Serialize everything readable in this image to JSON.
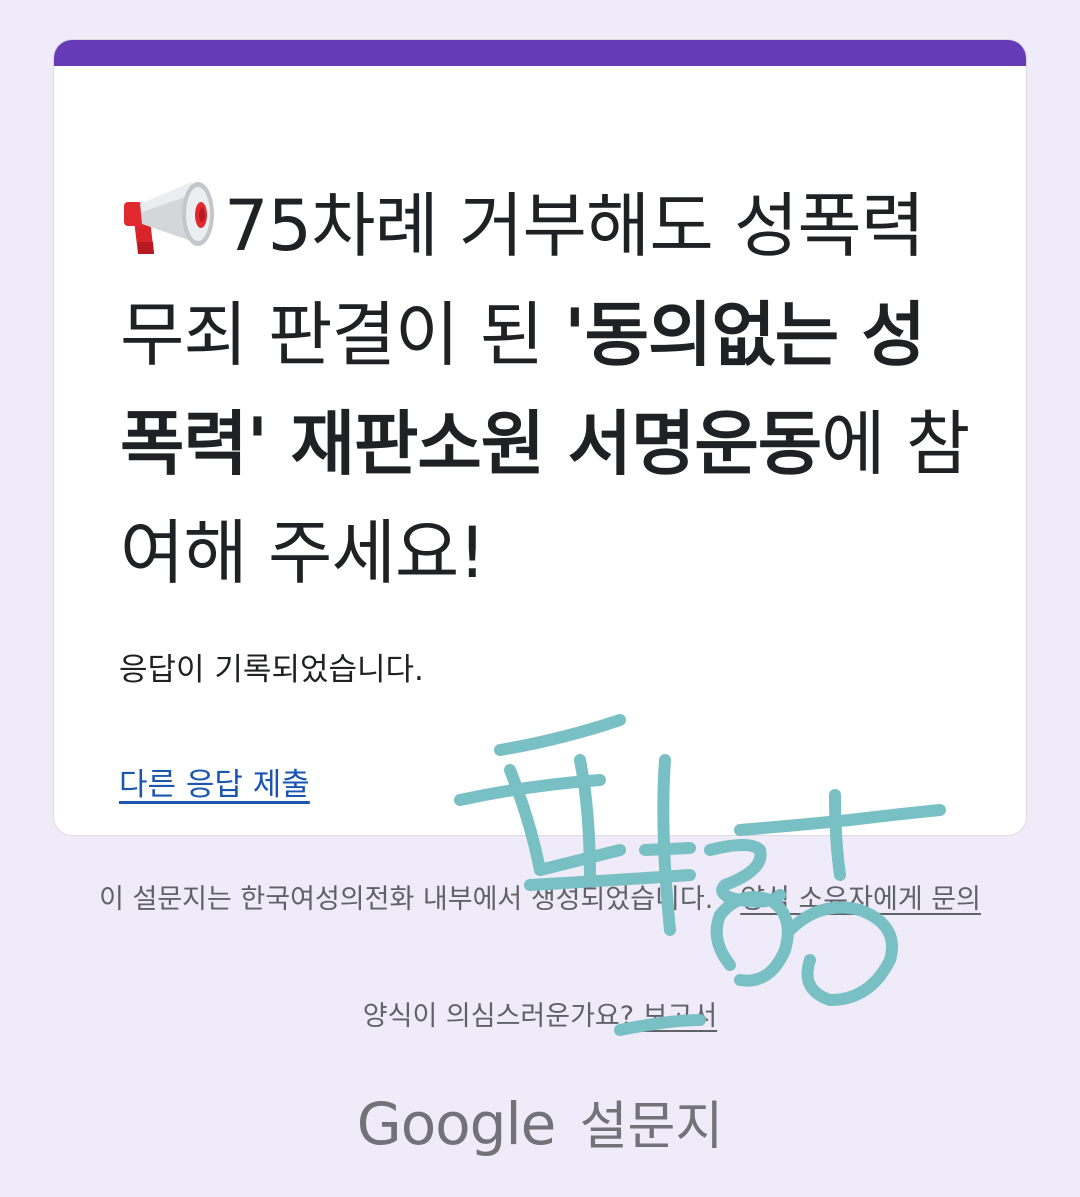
{
  "card": {
    "accent_color": "#673ab7",
    "title_icon": "megaphone-icon",
    "title_part1": "75차례 거부해도 성폭력 무죄 판결이 된 ",
    "title_bold": "'동의없는 성폭력' 재판소원 서명운동",
    "title_part2": "에 참여해 주세요!",
    "confirmation": "응답이 기록되었습니다.",
    "another_response_link": "다른 응답 제출"
  },
  "footer": {
    "created_text": "이 설문지는 한국여성의전화 내부에서 생성되었습니다. - ",
    "contact_owner_link": "양식 소유자에게 문의",
    "suspicious_text": "양식이 의심스러운가요? ",
    "report_link": "보고서",
    "logo_word": "Google",
    "logo_product": "설문지"
  },
  "overlay": {
    "handwritten_text": "팔랑",
    "color": "#79c0c4"
  }
}
